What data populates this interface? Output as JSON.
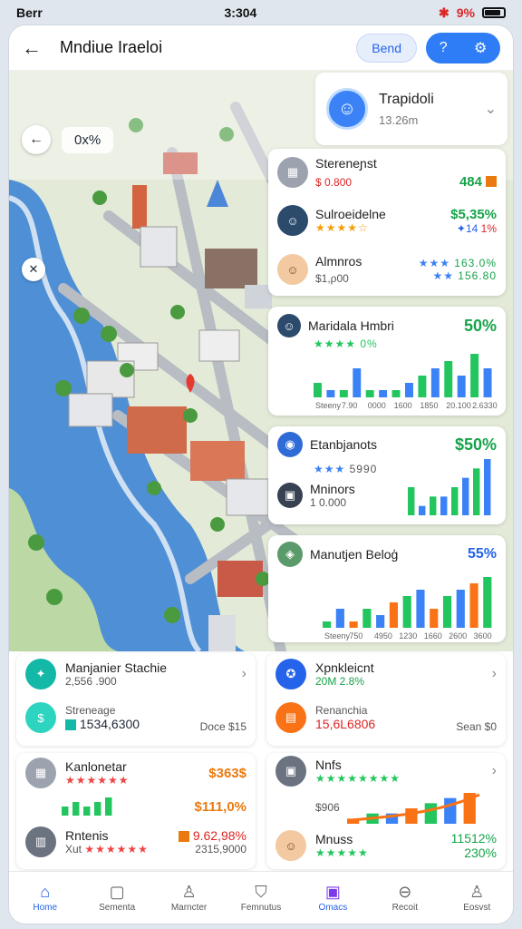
{
  "status": {
    "carrier": "Berr",
    "time": "3:304",
    "battery": "9%"
  },
  "header": {
    "title": "Mndiue Iraeloi",
    "pill": "Bend"
  },
  "map": {
    "zoom": "0x%"
  },
  "user": {
    "name": "Trapidoli",
    "sub": "13.26m"
  },
  "list1": {
    "title": "Stereneɲst",
    "title_sub": "$ 0.800",
    "title_val": "484",
    "item1": {
      "label": "Sulroeidelne",
      "value": "$5,35%",
      "sub": "✦14",
      "sub2": "1%"
    },
    "item2": {
      "label": "Almnros",
      "sub": "$1,ρ00",
      "value": "163.0%",
      "value2": "156.80"
    }
  },
  "chart1": {
    "title": "Maridala Hmbri",
    "pct": "50%",
    "sub": "0%",
    "ticks": [
      "Steeny",
      "7.90",
      "0000",
      "1600",
      "1850",
      "20.100",
      "2.6330"
    ]
  },
  "chart2": {
    "title": "Etanbjanots",
    "value": "$50%",
    "stars": "5990",
    "item": "Mninors",
    "item_sub": "1 0.000"
  },
  "chart3": {
    "title": "Manutjen Beloģ",
    "pct": "55%",
    "ticks": [
      "Steeny",
      "750",
      "4950",
      "1230",
      "1660",
      "2600",
      "3600"
    ]
  },
  "chart_data": [
    {
      "type": "bar",
      "title": "Maridala Hmbri",
      "categories": [
        "Steeny",
        "7.90",
        "0000",
        "1600",
        "1850",
        "20.100",
        "2.6330"
      ],
      "series": [
        {
          "values": [
            2,
            1,
            1,
            4,
            1,
            1,
            1,
            2,
            3,
            4,
            5,
            3,
            6,
            4
          ]
        }
      ],
      "colors": [
        "#22c55e",
        "#3b82f6"
      ]
    },
    {
      "type": "bar",
      "title": "Etanbjanots",
      "series": [
        {
          "values": [
            3,
            1,
            2,
            2,
            3,
            4,
            5,
            6
          ]
        }
      ],
      "colors": [
        "#22c55e",
        "#3b82f6"
      ]
    },
    {
      "type": "bar",
      "title": "Manutjen Beloģ",
      "categories": [
        "Steeny",
        "750",
        "4950",
        "1230",
        "1660",
        "2600",
        "3600"
      ],
      "series": [
        {
          "values": [
            1,
            3,
            1,
            3,
            2,
            4,
            5,
            6,
            3,
            5,
            6,
            7,
            8
          ]
        }
      ],
      "colors": [
        "#22c55e",
        "#3b82f6",
        "#f97316"
      ]
    },
    {
      "type": "bar",
      "title": "Nnfs",
      "series": [
        {
          "values": [
            1,
            2,
            2,
            3,
            4,
            5,
            6
          ]
        }
      ],
      "colors": [
        "#f97316",
        "#22c55e",
        "#3b82f6"
      ]
    }
  ],
  "bottom": {
    "c1": {
      "title": "Manjanier Stachie",
      "sub": "2,556 .900",
      "item": "Streneage",
      "item_val": "1534,6300",
      "tag": "Doce $15"
    },
    "c2": {
      "title": "Xpnkleicnt",
      "sub": "20M 2.8%",
      "item": "Renanchia",
      "item_val": "15,6L6806",
      "tag": "Sean $0"
    },
    "c3": {
      "title": "Kanlonetar",
      "val": "$363$",
      "val2": "$111,0%",
      "item": "Rntenis",
      "item_sub": "Xut",
      "item_val": "9.62,98%",
      "item_val2": "2315,9000"
    },
    "c4": {
      "title": "Nnfs",
      "stars": "$906",
      "item": "Mnuss",
      "item_val": "11512%",
      "item_val2": "230%"
    }
  },
  "nav": [
    "Home",
    "Sementa",
    "Marncter",
    "Femnutus",
    "Omacs",
    "Recoit",
    "Eosvst"
  ]
}
